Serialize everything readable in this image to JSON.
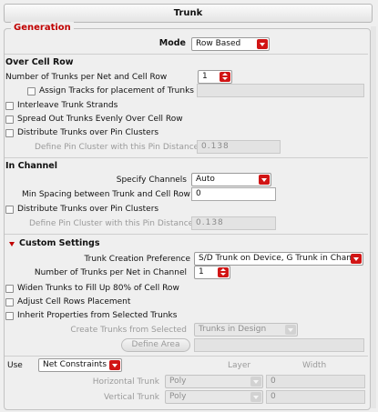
{
  "panel_title": "Trunk",
  "group_title": "Generation",
  "mode": {
    "label": "Mode",
    "value": "Row Based"
  },
  "over_cell_row": {
    "title": "Over Cell Row",
    "trunks_label": "Number of Trunks per Net and Cell Row",
    "trunks_value": "1",
    "assign_tracks": "Assign Tracks for placement of Trunks",
    "interleave": "Interleave Trunk Strands",
    "spread": "Spread Out Trunks Evenly Over Cell Row",
    "distribute": "Distribute Trunks over Pin Clusters",
    "pin_cluster_label": "Define Pin Cluster with this Pin Distance",
    "pin_cluster_value": "0.138"
  },
  "in_channel": {
    "title": "In Channel",
    "specify_label": "Specify Channels",
    "specify_value": "Auto",
    "min_spacing_label": "Min Spacing between Trunk and Cell Row",
    "min_spacing_value": "0",
    "distribute": "Distribute Trunks over Pin Clusters",
    "pin_cluster_label": "Define Pin Cluster with this Pin Distance",
    "pin_cluster_value": "0.138"
  },
  "custom": {
    "title": "Custom Settings",
    "preference_label": "Trunk Creation Preference",
    "preference_value": "S/D Trunk on Device, G Trunk in Chann",
    "per_net_label": "Number of Trunks per Net in Channel",
    "per_net_value": "1",
    "widen": "Widen Trunks to Fill Up 80% of Cell Row",
    "adjust": "Adjust Cell Rows Placement",
    "inherit": "Inherit Properties from Selected Trunks",
    "create_from_label": "Create Trunks from Selected",
    "create_from_value": "Trunks in Design",
    "define_area": "Define Area"
  },
  "use": {
    "label": "Use",
    "value": "Net Constraints",
    "layer_header": "Layer",
    "width_header": "Width",
    "horizontal_label": "Horizontal Trunk",
    "horizontal_layer": "Poly",
    "horizontal_width": "0",
    "vertical_label": "Vertical Trunk",
    "vertical_layer": "Poly",
    "vertical_width": "0"
  },
  "colors": {
    "accent": "#c00000",
    "button": "#d11515"
  }
}
